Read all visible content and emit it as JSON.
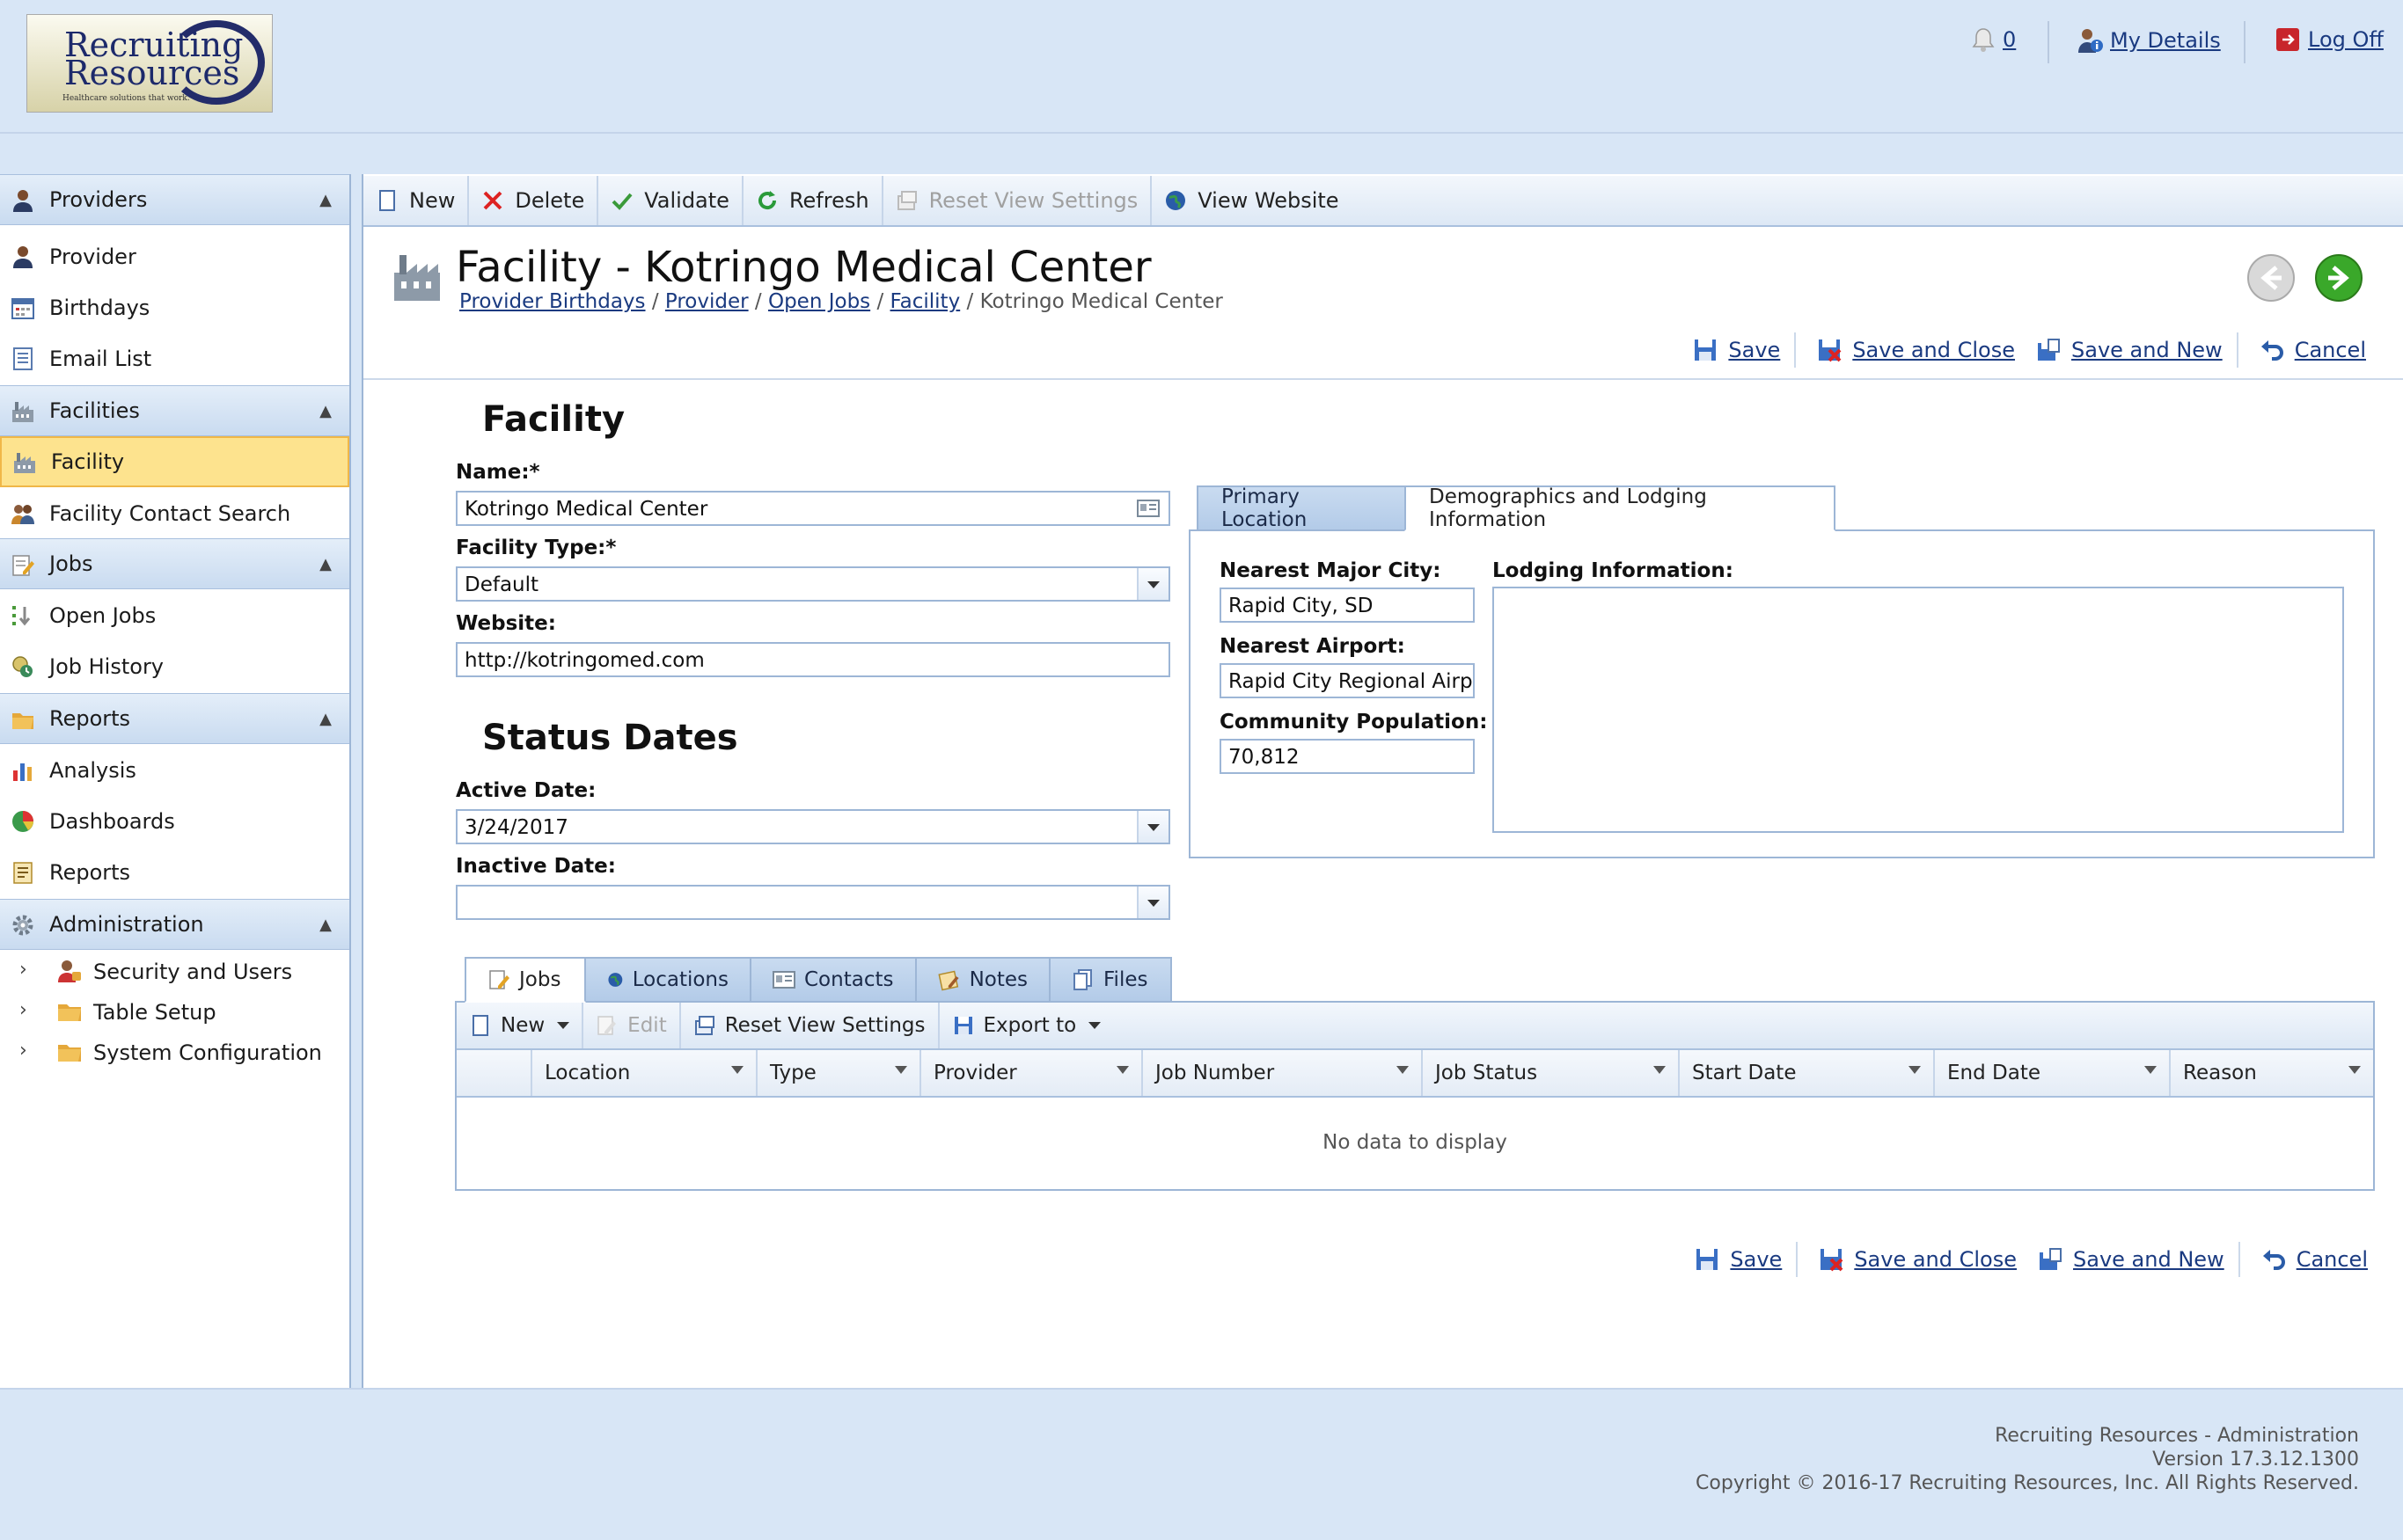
{
  "header": {
    "logo_line1": "Recruiting",
    "logo_line2": "Resources",
    "logo_tagline": "Healthcare solutions that work.",
    "notification_count": "0",
    "my_details": "My Details",
    "log_off": "Log Off"
  },
  "sidebar": {
    "groups": [
      {
        "label": "Providers",
        "items": [
          "Provider",
          "Birthdays",
          "Email List"
        ]
      },
      {
        "label": "Facilities",
        "items": [
          "Facility",
          "Facility Contact Search"
        ]
      },
      {
        "label": "Jobs",
        "items": [
          "Open Jobs",
          "Job History"
        ]
      },
      {
        "label": "Reports",
        "items": [
          "Analysis",
          "Dashboards",
          "Reports"
        ]
      },
      {
        "label": "Administration",
        "items": [
          "Security and Users",
          "Table Setup",
          "System Configuration"
        ]
      }
    ],
    "selected": "Facility"
  },
  "toolbar": {
    "new": "New",
    "delete": "Delete",
    "validate": "Validate",
    "refresh": "Refresh",
    "reset_view": "Reset View Settings",
    "view_website": "View Website"
  },
  "page": {
    "title": "Facility - Kotringo Medical Center",
    "breadcrumbs": [
      "Provider Birthdays",
      "Provider",
      "Open Jobs",
      "Facility"
    ],
    "breadcrumb_current": "Kotringo Medical Center",
    "breadcrumb_sep": "/"
  },
  "actions": {
    "save": "Save",
    "save_close": "Save and Close",
    "save_new": "Save and New",
    "cancel": "Cancel"
  },
  "form": {
    "section_facility": "Facility",
    "name_label": "Name:*",
    "name_value": "Kotringo Medical Center",
    "type_label": "Facility Type:*",
    "type_value": "Default",
    "website_label": "Website:",
    "website_value": "http://kotringomed.com",
    "section_status": "Status Dates",
    "active_label": "Active Date:",
    "active_value": "3/24/2017",
    "inactive_label": "Inactive Date:",
    "inactive_value": ""
  },
  "right_tabs": {
    "tab1": "Primary Location",
    "tab2": "Demographics and Lodging Information",
    "city_label": "Nearest Major City:",
    "city_value": "Rapid City, SD",
    "airport_label": "Nearest Airport:",
    "airport_value": "Rapid City Regional Airport",
    "population_label": "Community Population:",
    "population_value": "70,812",
    "lodging_label": "Lodging Information:"
  },
  "bottom_tabs": [
    "Jobs",
    "Locations",
    "Contacts",
    "Notes",
    "Files"
  ],
  "grid": {
    "toolbar": {
      "new": "New",
      "edit": "Edit",
      "reset": "Reset View Settings",
      "export": "Export to"
    },
    "columns": [
      "Location",
      "Type",
      "Provider",
      "Job Number",
      "Job Status",
      "Start Date",
      "End Date",
      "Reason"
    ],
    "empty": "No data to display"
  },
  "footer": {
    "line1": "Recruiting Resources - Administration",
    "line2": "Version 17.3.12.1300",
    "line3": "Copyright © 2016-17 Recruiting Resources, Inc. All Rights Reserved."
  }
}
